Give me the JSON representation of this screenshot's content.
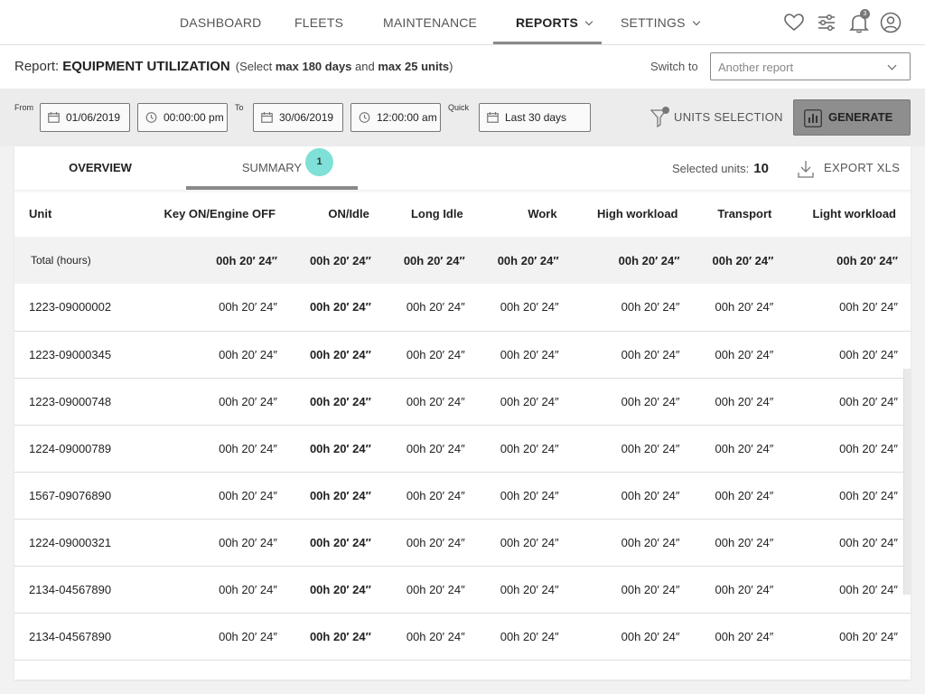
{
  "nav": {
    "items": [
      {
        "label": "DASHBOARD",
        "dropdown": false
      },
      {
        "label": "FLEETS",
        "dropdown": false
      },
      {
        "label": "MAINTENANCE",
        "dropdown": false
      },
      {
        "label": "REPORTS",
        "dropdown": true,
        "active": true
      },
      {
        "label": "SETTINGS",
        "dropdown": true
      }
    ],
    "icons": [
      "heart-icon",
      "sliders-icon",
      "bell-icon",
      "user-icon"
    ],
    "notification_count": "3"
  },
  "report": {
    "label": "Report:",
    "name": "EQUIPMENT UTILIZATION",
    "note_prefix": "(Select",
    "note_days": "max 180 days",
    "note_and": "and",
    "note_units": "max 25 units",
    "note_suffix": ")",
    "switch_label": "Switch to",
    "switch_placeholder": "Another report"
  },
  "filters": {
    "from_label": "From",
    "from_date": "01/06/2019",
    "from_time": "00:00:00 pm",
    "to_label": "To",
    "to_date": "30/06/2019",
    "to_time": "12:00:00 am",
    "quick_label": "Quick",
    "quick_value": "Last 30 days",
    "units_selection_label": "UNITS SELECTION",
    "generate_label": "GENERATE"
  },
  "tabs": {
    "overview": "OVERVIEW",
    "summary": "SUMMARY",
    "summary_badge": "1"
  },
  "toolbar": {
    "selected_units_label": "Selected units:",
    "selected_units_count": "10",
    "export_label": "EXPORT XLS"
  },
  "table": {
    "columns": [
      "Unit",
      "Key ON/Engine OFF",
      "ON/Idle",
      "Long Idle",
      "Work",
      "High workload",
      "Transport",
      "Light workload"
    ],
    "total": {
      "label": "Total (hours)",
      "values": [
        "00h 20′ 24″",
        "00h 20′ 24″",
        "00h 20′ 24″",
        "00h 20′ 24″",
        "00h 20′ 24″",
        "00h 20′ 24″",
        "00h 20′ 24″"
      ]
    },
    "rows": [
      {
        "unit": "1223-09000002",
        "values": [
          "00h 20′ 24″",
          "00h 20′ 24″",
          "00h 20′ 24″",
          "00h 20′ 24″",
          "00h 20′ 24″",
          "00h 20′ 24″",
          "00h 20′ 24″"
        ]
      },
      {
        "unit": "1223-09000345",
        "values": [
          "00h 20′ 24″",
          "00h 20′ 24″",
          "00h 20′ 24″",
          "00h 20′ 24″",
          "00h 20′ 24″",
          "00h 20′ 24″",
          "00h 20′ 24″"
        ]
      },
      {
        "unit": "1223-09000748",
        "values": [
          "00h 20′ 24″",
          "00h 20′ 24″",
          "00h 20′ 24″",
          "00h 20′ 24″",
          "00h 20′ 24″",
          "00h 20′ 24″",
          "00h 20′ 24″"
        ]
      },
      {
        "unit": "1224-09000789",
        "values": [
          "00h 20′ 24″",
          "00h 20′ 24″",
          "00h 20′ 24″",
          "00h 20′ 24″",
          "00h 20′ 24″",
          "00h 20′ 24″",
          "00h 20′ 24″"
        ]
      },
      {
        "unit": "1567-09076890",
        "values": [
          "00h 20′ 24″",
          "00h 20′ 24″",
          "00h 20′ 24″",
          "00h 20′ 24″",
          "00h 20′ 24″",
          "00h 20′ 24″",
          "00h 20′ 24″"
        ]
      },
      {
        "unit": "1224-09000321",
        "values": [
          "00h 20′ 24″",
          "00h 20′ 24″",
          "00h 20′ 24″",
          "00h 20′ 24″",
          "00h 20′ 24″",
          "00h 20′ 24″",
          "00h 20′ 24″"
        ]
      },
      {
        "unit": "2134-04567890",
        "values": [
          "00h 20′ 24″",
          "00h 20′ 24″",
          "00h 20′ 24″",
          "00h 20′ 24″",
          "00h 20′ 24″",
          "00h 20′ 24″",
          "00h 20′ 24″"
        ]
      },
      {
        "unit": "2134-04567890",
        "values": [
          "00h 20′ 24″",
          "00h 20′ 24″",
          "00h 20′ 24″",
          "00h 20′ 24″",
          "00h 20′ 24″",
          "00h 20′ 24″",
          "00h 20′ 24″"
        ]
      }
    ]
  },
  "colors": {
    "accent_badge": "#7ee0d6",
    "generate_button": "#8e8e8e",
    "active_underline": "#8a8a8a"
  }
}
